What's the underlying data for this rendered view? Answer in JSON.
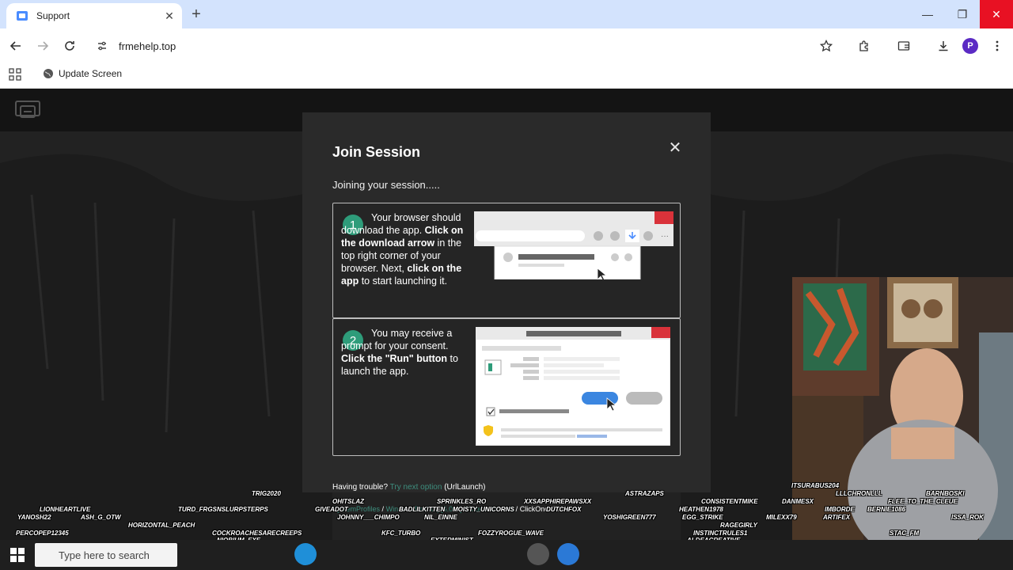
{
  "browser": {
    "tab_title": "Support",
    "url": "frmehelp.top",
    "bookmark_label": "Update Screen",
    "profile_initial": "P"
  },
  "modal": {
    "title": "Join Session",
    "subtitle": "Joining your session.....",
    "step1": {
      "number": "1",
      "text_a": "Your browser should download the app. ",
      "bold_a": "Click on the download arrow",
      "text_b": " in the top right corner of your browser. Next, ",
      "bold_b": "click on the app",
      "text_c": " to start launching it."
    },
    "step2": {
      "number": "2",
      "text_a": "You may receive a prompt for your consent. ",
      "bold_a": "Click the \"Run\" button",
      "text_b": " to launch the app."
    },
    "help_prefix": "Having trouble?",
    "help_link": "Try next option",
    "help_suffix": "(UrlLaunch)",
    "crumb_1": "SystemProfiles",
    "crumb_2": "WindowsDesktop[6.0-X] Chrome Default",
    "crumb_3": "ClickOnceRun",
    "crumb_sep": "/"
  },
  "chat_names": [
    "TRIG2020",
    "LIONHEARTLIVE",
    "TURD_FRGSNSLURPSTERPS",
    "OHITSLAZ",
    "SPRINKLES_RO",
    "XXSAPPHIREPAWSXX",
    "ASTRAZAPS",
    "CONSISTENTMIKE",
    "ITSURABUS204",
    "BARNBOSKI",
    "YANOSH22",
    "ASH_G_OTW",
    "GIVEADOT",
    "BADLILKITTEN",
    "MOISTY_UNICORNS",
    "DUTCHFOX",
    "HEATHEN1978",
    "DANMESX",
    "LLLCHRONLLL",
    "FLEE_TO_THE_CLEUE",
    "HORIZONTAL_PEACH",
    "JOHNNY___CHIMPO",
    "NIL_EINNE",
    "YOSHIGREEN777",
    "EGG_STRIKE",
    "MILEXX79",
    "ARTIFEX",
    "IMBORDE",
    "BERNIE1086",
    "PERCOPEP12345",
    "COCKROACHESARECREEPS",
    "NIOBIUM_EXE",
    "KFC_TURBO",
    "EXTERMINIST",
    "FOZZYROGUE_WAVE",
    "INSTINCTRULES1",
    "ALDEACREATIVE",
    "STAC_FM",
    "ISSA_ROK",
    "RAGEGIRLY"
  ],
  "taskbar": {
    "search_placeholder": "Type here to search"
  },
  "colors": {
    "tab_strip": "#d3e3fd",
    "badge": "#2e9c7a",
    "link": "#3e8e7e",
    "close_red": "#e81123",
    "profile": "#5b2bc4"
  }
}
